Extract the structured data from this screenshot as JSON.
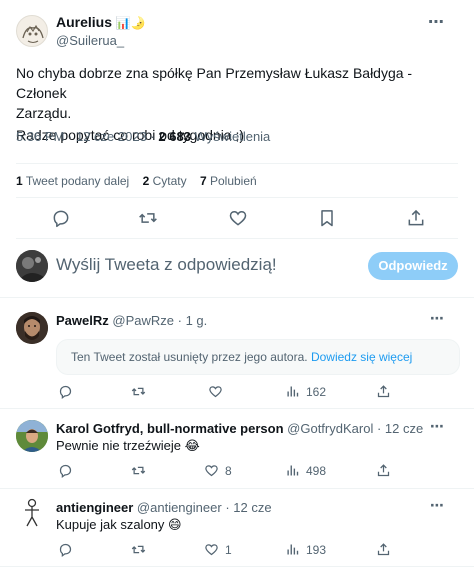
{
  "main_tweet": {
    "author_name": "Aurelius",
    "author_emoji": "📊🌛",
    "handle": "@Suilerua_",
    "text_line1": "No chyba dobrze zna spółkę Pan Przemysław Łukasz Bałdyga - Członek",
    "text_line2": "Zarządu.",
    "text_line3": "Radze popytać co robi od tygodnia ;)",
    "timestamp": "5:36 PM · 12 cze 2023 ·",
    "views_count": "2 683",
    "views_label": "Wyświetlenia",
    "stats": {
      "retweets_count": "1",
      "retweets_label": "Tweet podany dalej",
      "quotes_count": "2",
      "quotes_label": "Cytaty",
      "likes_count": "7",
      "likes_label": "Polubień"
    }
  },
  "reply_composer": {
    "placeholder": "Wyślij Tweeta z odpowiedzią!",
    "button_label": "Odpowiedz"
  },
  "replies": [
    {
      "author_name": "PawelRz",
      "handle": "@PawRze",
      "time": "1 g.",
      "notice_text": "Ten Tweet został usunięty przez jego autora.",
      "notice_link": "Dowiedz się więcej",
      "likes": "",
      "views": "162"
    },
    {
      "author_name": "Karol Gotfryd, bull-normative person",
      "handle": "@GotfrydKarol",
      "time": "12 cze",
      "text": "Pewnie nie trzeźwieje 😂",
      "likes": "8",
      "views": "498"
    },
    {
      "author_name": "antiengineer",
      "handle": "@antiengineer",
      "time": "12 cze",
      "text": "Kupuje jak szalony 😄",
      "likes": "1",
      "views": "193"
    }
  ],
  "separator": "·",
  "more_icon": "⋯",
  "colors": {
    "accent": "#1d9bf0",
    "button_disabled": "#8ecdf8",
    "muted": "#536471",
    "divider": "#eff3f4",
    "notice_bg": "#f7f9f9"
  }
}
